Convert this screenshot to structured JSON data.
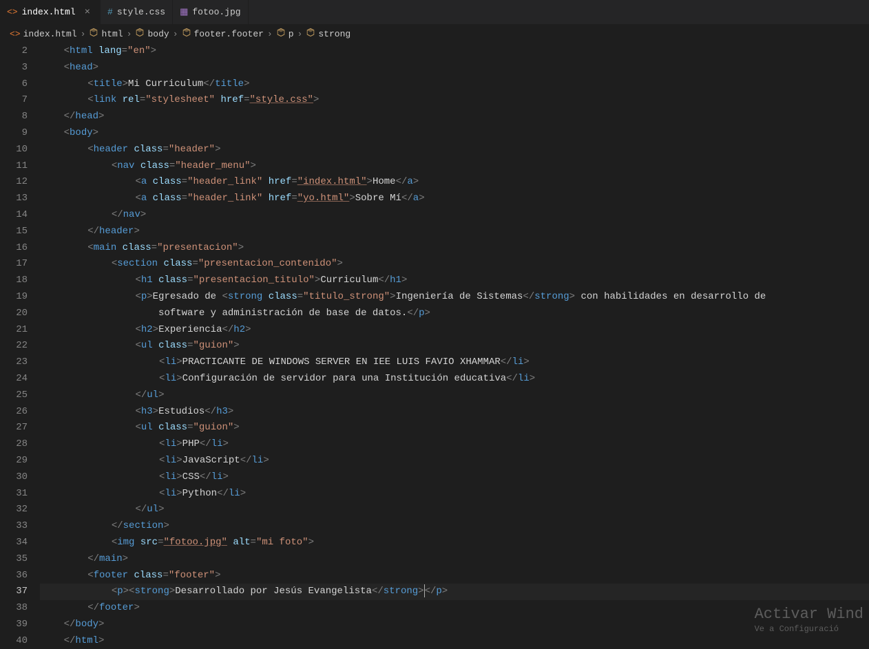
{
  "tabs": [
    {
      "label": "index.html",
      "icon": "code-icon",
      "iconColor": "#e37933",
      "active": true
    },
    {
      "label": "style.css",
      "icon": "hash-icon",
      "iconColor": "#519aba",
      "active": false
    },
    {
      "label": "fotoo.jpg",
      "icon": "image-icon",
      "iconColor": "#a074c4",
      "active": false
    }
  ],
  "breadcrumbs": [
    {
      "icon": "code-icon",
      "iconColor": "#e37933",
      "label": "index.html"
    },
    {
      "icon": "cube-icon",
      "iconColor": "#b9955b",
      "label": "html"
    },
    {
      "icon": "cube-icon",
      "iconColor": "#b9955b",
      "label": "body"
    },
    {
      "icon": "cube-icon",
      "iconColor": "#b9955b",
      "label": "footer.footer"
    },
    {
      "icon": "cube-icon",
      "iconColor": "#b9955b",
      "label": "p"
    },
    {
      "icon": "cube-icon",
      "iconColor": "#b9955b",
      "label": "strong"
    }
  ],
  "lineNumbers": [
    "2",
    "3",
    "6",
    "7",
    "8",
    "9",
    "10",
    "11",
    "12",
    "13",
    "14",
    "15",
    "16",
    "17",
    "18",
    "19",
    "20",
    "21",
    "22",
    "23",
    "24",
    "25",
    "26",
    "27",
    "28",
    "29",
    "30",
    "31",
    "32",
    "33",
    "34",
    "35",
    "36",
    "37",
    "38",
    "39",
    "40"
  ],
  "currentLine": 37,
  "watermark": {
    "big": "Activar Wind",
    "small": "Ve a Configuració"
  },
  "code": {
    "l2": {
      "tag": "html",
      "attr": "lang",
      "val": "\"en\""
    },
    "l3": {
      "open": "head"
    },
    "l6": {
      "tag": "title",
      "text": "Mi Curriculum"
    },
    "l7": {
      "tag": "link",
      "attrs": [
        [
          "rel",
          "\"stylesheet\""
        ],
        [
          "href",
          "\"style.css\""
        ]
      ],
      "linked": "style.css"
    },
    "l8": {
      "close": "head"
    },
    "l9": {
      "open": "body"
    },
    "l10": {
      "tag": "header",
      "attr": "class",
      "val": "\"header\""
    },
    "l11": {
      "tag": "nav",
      "attr": "class",
      "val": "\"header_menu\""
    },
    "l12": {
      "tag": "a",
      "attrs": [
        [
          "class",
          "\"header_link\""
        ],
        [
          "href",
          "\"index.html\""
        ]
      ],
      "text": "Home",
      "linked": "index.html"
    },
    "l13": {
      "tag": "a",
      "attrs": [
        [
          "class",
          "\"header_link\""
        ],
        [
          "href",
          "\"yo.html\""
        ]
      ],
      "text": "Sobre Mí",
      "linked": "yo.html"
    },
    "l14": {
      "close": "nav"
    },
    "l15": {
      "close": "header"
    },
    "l16": {
      "tag": "main",
      "attr": "class",
      "val": "\"presentacion\""
    },
    "l17": {
      "tag": "section",
      "attr": "class",
      "val": "\"presentacion_contenido\""
    },
    "l18": {
      "tag": "h1",
      "attr": "class",
      "val": "\"presentacion_titulo\"",
      "text": "Curriculum"
    },
    "l19": {
      "pre": "Egresado de ",
      "stag": "strong",
      "sattr": "class",
      "sval": "\"titulo_strong\"",
      "stext": "Ingeniería de Sistemas",
      "post": " con habilidades en desarrollo de"
    },
    "l20": {
      "text": "software y administración de base de datos.",
      "close": "p"
    },
    "l21": {
      "tag": "h2",
      "text": "Experiencia"
    },
    "l22": {
      "tag": "ul",
      "attr": "class",
      "val": "\"guion\""
    },
    "l23": {
      "li": "PRACTICANTE DE WINDOWS SERVER EN IEE LUIS FAVIO XHAMMAR"
    },
    "l24": {
      "li": "Configuración de servidor para una Institución educativa"
    },
    "l25": {
      "close": "ul"
    },
    "l26": {
      "tag": "h3",
      "text": "Estudios"
    },
    "l27": {
      "tag": "ul",
      "attr": "class",
      "val": "\"guion\""
    },
    "l28": {
      "li": "PHP"
    },
    "l29": {
      "li": "JavaScript"
    },
    "l30": {
      "li": "CSS"
    },
    "l31": {
      "li": "Python"
    },
    "l32": {
      "close": "ul"
    },
    "l33": {
      "close": "section"
    },
    "l34": {
      "tag": "img",
      "attrs": [
        [
          "src",
          "\"fotoo.jpg\""
        ],
        [
          "alt",
          "\"mi foto\""
        ]
      ],
      "linked": "fotoo.jpg"
    },
    "l35": {
      "close": "main"
    },
    "l36": {
      "tag": "footer",
      "attr": "class",
      "val": "\"footer\""
    },
    "l37": {
      "ptext": "Desarrollado por Jesús Evangelista"
    },
    "l38": {
      "close": "footer"
    },
    "l39": {
      "close": "body"
    },
    "l40": {
      "close": "html"
    }
  }
}
